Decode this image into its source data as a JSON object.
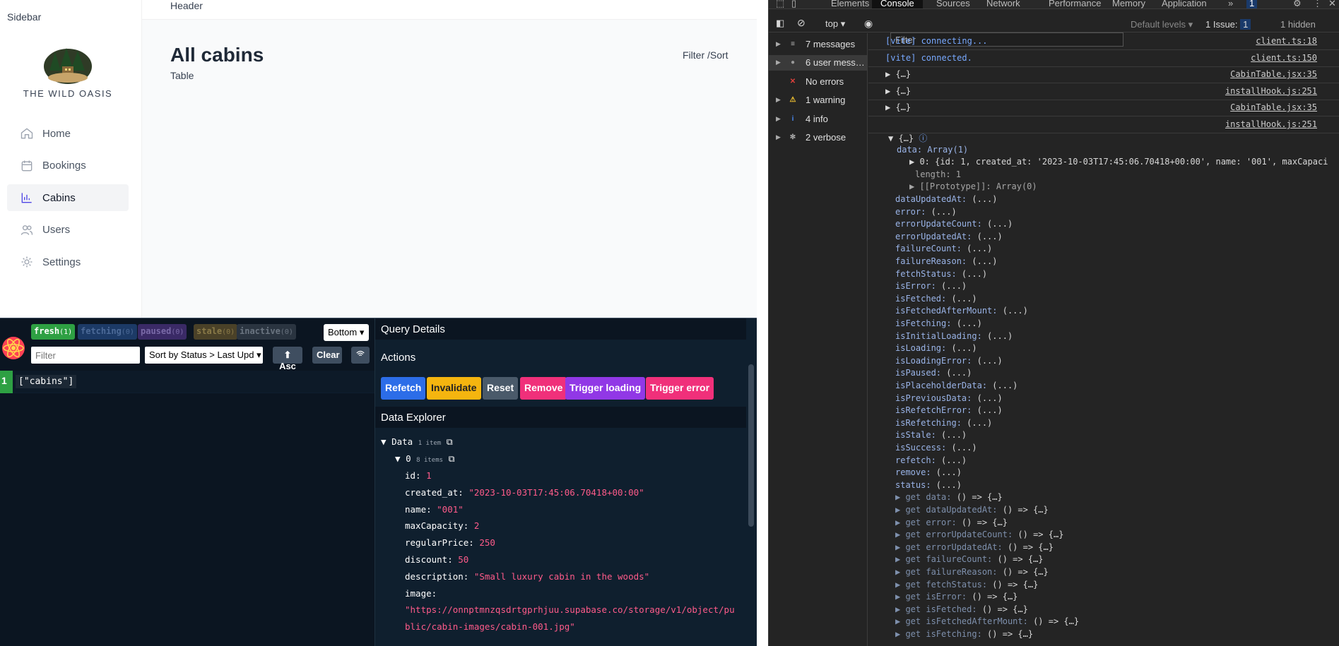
{
  "sidebar": {
    "label": "Sidebar",
    "brand": "THE WILD OASIS",
    "items": [
      {
        "label": "Home",
        "icon": "home-icon"
      },
      {
        "label": "Bookings",
        "icon": "calendar-icon"
      },
      {
        "label": "Cabins",
        "icon": "chart-icon"
      },
      {
        "label": "Users",
        "icon": "users-icon"
      },
      {
        "label": "Settings",
        "icon": "gear-icon"
      }
    ]
  },
  "header": {
    "label": "Header"
  },
  "page": {
    "title": "All cabins",
    "subtitle": "Table",
    "filter_sort": "Filter /Sort"
  },
  "rq": {
    "pills": [
      {
        "label": "fresh",
        "count": "(1)",
        "bg": "#2ea043",
        "fg": "#ffffff"
      },
      {
        "label": "fetching",
        "count": "(0)",
        "bg": "#1c3a66",
        "fg": "#4c6a98"
      },
      {
        "label": "paused",
        "count": "(0)",
        "bg": "#3a2a66",
        "fg": "#7a6aa8"
      },
      {
        "label": "stale",
        "count": "(0)",
        "bg": "#4a4128",
        "fg": "#8a7a48"
      },
      {
        "label": "inactive",
        "count": "(0)",
        "bg": "#2a3440",
        "fg": "#6a7480"
      }
    ],
    "position": "Bottom",
    "filter_placeholder": "Filter",
    "sort": "Sort by Status > Last Upd",
    "asc": "⬆ Asc",
    "clear": "Clear",
    "query": {
      "count": "1",
      "key": "[\"cabins\"]"
    },
    "details": "Query Details",
    "actions_title": "Actions",
    "actions": [
      {
        "label": "Refetch",
        "bg": "#2c6de8"
      },
      {
        "label": "Invalidate",
        "bg": "#f5b50f",
        "fg": "#222"
      },
      {
        "label": "Reset",
        "bg": "#4a5a6a"
      },
      {
        "label": "Remove",
        "bg": "#f0307a"
      },
      {
        "label": "Trigger loading",
        "bg": "#9138e6"
      },
      {
        "label": "Trigger error",
        "bg": "#f0307a"
      }
    ],
    "explorer_title": "Data Explorer",
    "data_label": "Data",
    "data_count": "1 item",
    "item_label": "0",
    "item_count": "8 items",
    "fields": [
      {
        "k": "id",
        "v": "1",
        "t": "num"
      },
      {
        "k": "created_at",
        "v": "\"2023-10-03T17:45:06.70418+00:00\"",
        "t": "s"
      },
      {
        "k": "name",
        "v": "\"001\"",
        "t": "s"
      },
      {
        "k": "maxCapacity",
        "v": "2",
        "t": "num"
      },
      {
        "k": "regularPrice",
        "v": "250",
        "t": "num"
      },
      {
        "k": "discount",
        "v": "50",
        "t": "num"
      },
      {
        "k": "description",
        "v": "\"Small luxury cabin in the woods\"",
        "t": "s"
      },
      {
        "k": "image",
        "v": "",
        "t": "s"
      }
    ],
    "image_l1": "\"https://onnptmnzqsdrtgprhjuu.supabase.co/storage/v1/object/pu",
    "image_l2": "blic/cabin-images/cabin-001.jpg\""
  },
  "devtools": {
    "tabs": [
      "Elements",
      "Console",
      "Sources",
      "Network",
      "Performance",
      "Memory",
      "Application"
    ],
    "top": "top",
    "filter_placeholder": "Filter",
    "levels": "Default levels",
    "issues": "1 Issue:",
    "issues_count": "1",
    "hidden": "1 hidden",
    "badge": "1",
    "side": [
      {
        "label": "7 messages",
        "icon": "list-icon"
      },
      {
        "label": "6 user mess…",
        "icon": "user-icon"
      },
      {
        "label": "No errors",
        "icon": "error-icon"
      },
      {
        "label": "1 warning",
        "icon": "warning-icon"
      },
      {
        "label": "4 info",
        "icon": "info-icon"
      },
      {
        "label": "2 verbose",
        "icon": "bug-icon"
      }
    ],
    "logs": [
      {
        "text": "[vite] connecting...",
        "src": "client.ts:18",
        "vite": true
      },
      {
        "text": "[vite] connected.",
        "src": "client.ts:150",
        "vite": true
      },
      {
        "text": "▶ {…}",
        "src": "CabinTable.jsx:35"
      },
      {
        "text": "▶ {…}",
        "src": "installHook.js:251"
      },
      {
        "text": "▶ {…}",
        "src": "CabinTable.jsx:35"
      },
      {
        "text": "",
        "src": "installHook.js:251"
      }
    ],
    "obj_head": "▼ {…}",
    "data_line": "data: Array(1)",
    "item0": "▶ 0: {id: 1, created_at: '2023-10-03T17:45:06.70418+00:00', name: '001', maxCapaci",
    "length": "length: 1",
    "proto": "▶ [[Prototype]]: Array(0)",
    "props": [
      "dataUpdatedAt",
      "error",
      "errorUpdateCount",
      "errorUpdatedAt",
      "failureCount",
      "failureReason",
      "fetchStatus",
      "isError",
      "isFetched",
      "isFetchedAfterMount",
      "isFetching",
      "isInitialLoading",
      "isLoading",
      "isLoadingError",
      "isPaused",
      "isPlaceholderData",
      "isPreviousData",
      "isRefetchError",
      "isRefetching",
      "isStale",
      "isSuccess",
      "refetch",
      "remove",
      "status"
    ],
    "getters": [
      "data",
      "dataUpdatedAt",
      "error",
      "errorUpdateCount",
      "errorUpdatedAt",
      "failureCount",
      "failureReason",
      "fetchStatus",
      "isError",
      "isFetched",
      "isFetchedAfterMount",
      "isFetching"
    ]
  }
}
